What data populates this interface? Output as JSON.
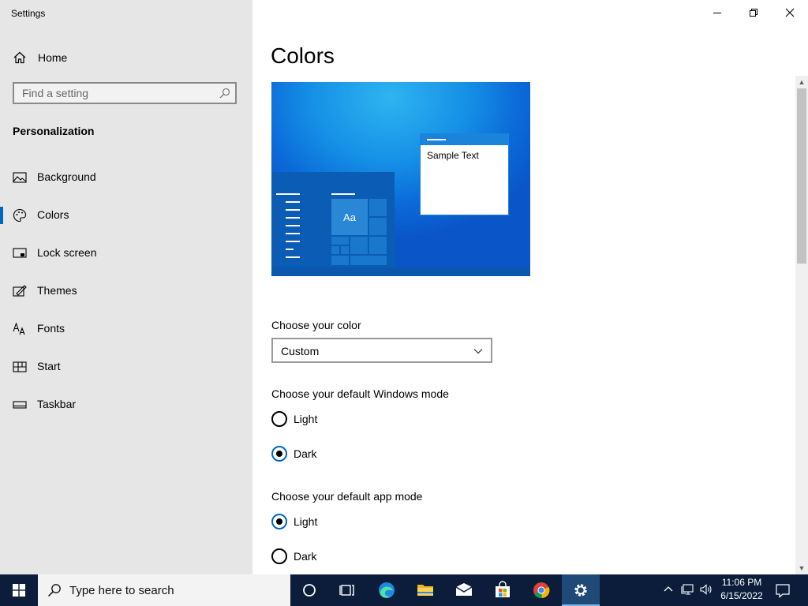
{
  "window": {
    "title": "Settings",
    "controls": {
      "minimize": "minimize",
      "restore": "restore",
      "close": "close"
    }
  },
  "sidebar": {
    "home_label": "Home",
    "search_placeholder": "Find a setting",
    "section_title": "Personalization",
    "items": [
      {
        "label": "Background",
        "icon": "background-icon"
      },
      {
        "label": "Colors",
        "icon": "palette-icon",
        "selected": true
      },
      {
        "label": "Lock screen",
        "icon": "lock-screen-icon"
      },
      {
        "label": "Themes",
        "icon": "themes-icon"
      },
      {
        "label": "Fonts",
        "icon": "fonts-icon"
      },
      {
        "label": "Start",
        "icon": "start-icon"
      },
      {
        "label": "Taskbar",
        "icon": "taskbar-icon"
      }
    ]
  },
  "main": {
    "title": "Colors",
    "preview": {
      "sample_text": "Sample Text",
      "tile_text": "Aa"
    },
    "choose_color": {
      "label": "Choose your color",
      "value": "Custom"
    },
    "windows_mode": {
      "label": "Choose your default Windows mode",
      "options": [
        {
          "label": "Light",
          "checked": false
        },
        {
          "label": "Dark",
          "checked": true
        }
      ]
    },
    "app_mode": {
      "label": "Choose your default app mode",
      "options": [
        {
          "label": "Light",
          "checked": true
        },
        {
          "label": "Dark",
          "checked": false
        }
      ]
    }
  },
  "taskbar": {
    "search_placeholder": "Type here to search",
    "apps": [
      "cortana",
      "task-view",
      "edge",
      "file-explorer",
      "mail",
      "store",
      "chrome",
      "settings"
    ],
    "active_app": "settings",
    "clock": {
      "time": "11:06 PM",
      "date": "6/15/2022"
    }
  },
  "colors": {
    "accent": "#0067c0",
    "sidebar_bg": "#e6e6e6",
    "taskbar_bg": "#0b1d3a"
  }
}
